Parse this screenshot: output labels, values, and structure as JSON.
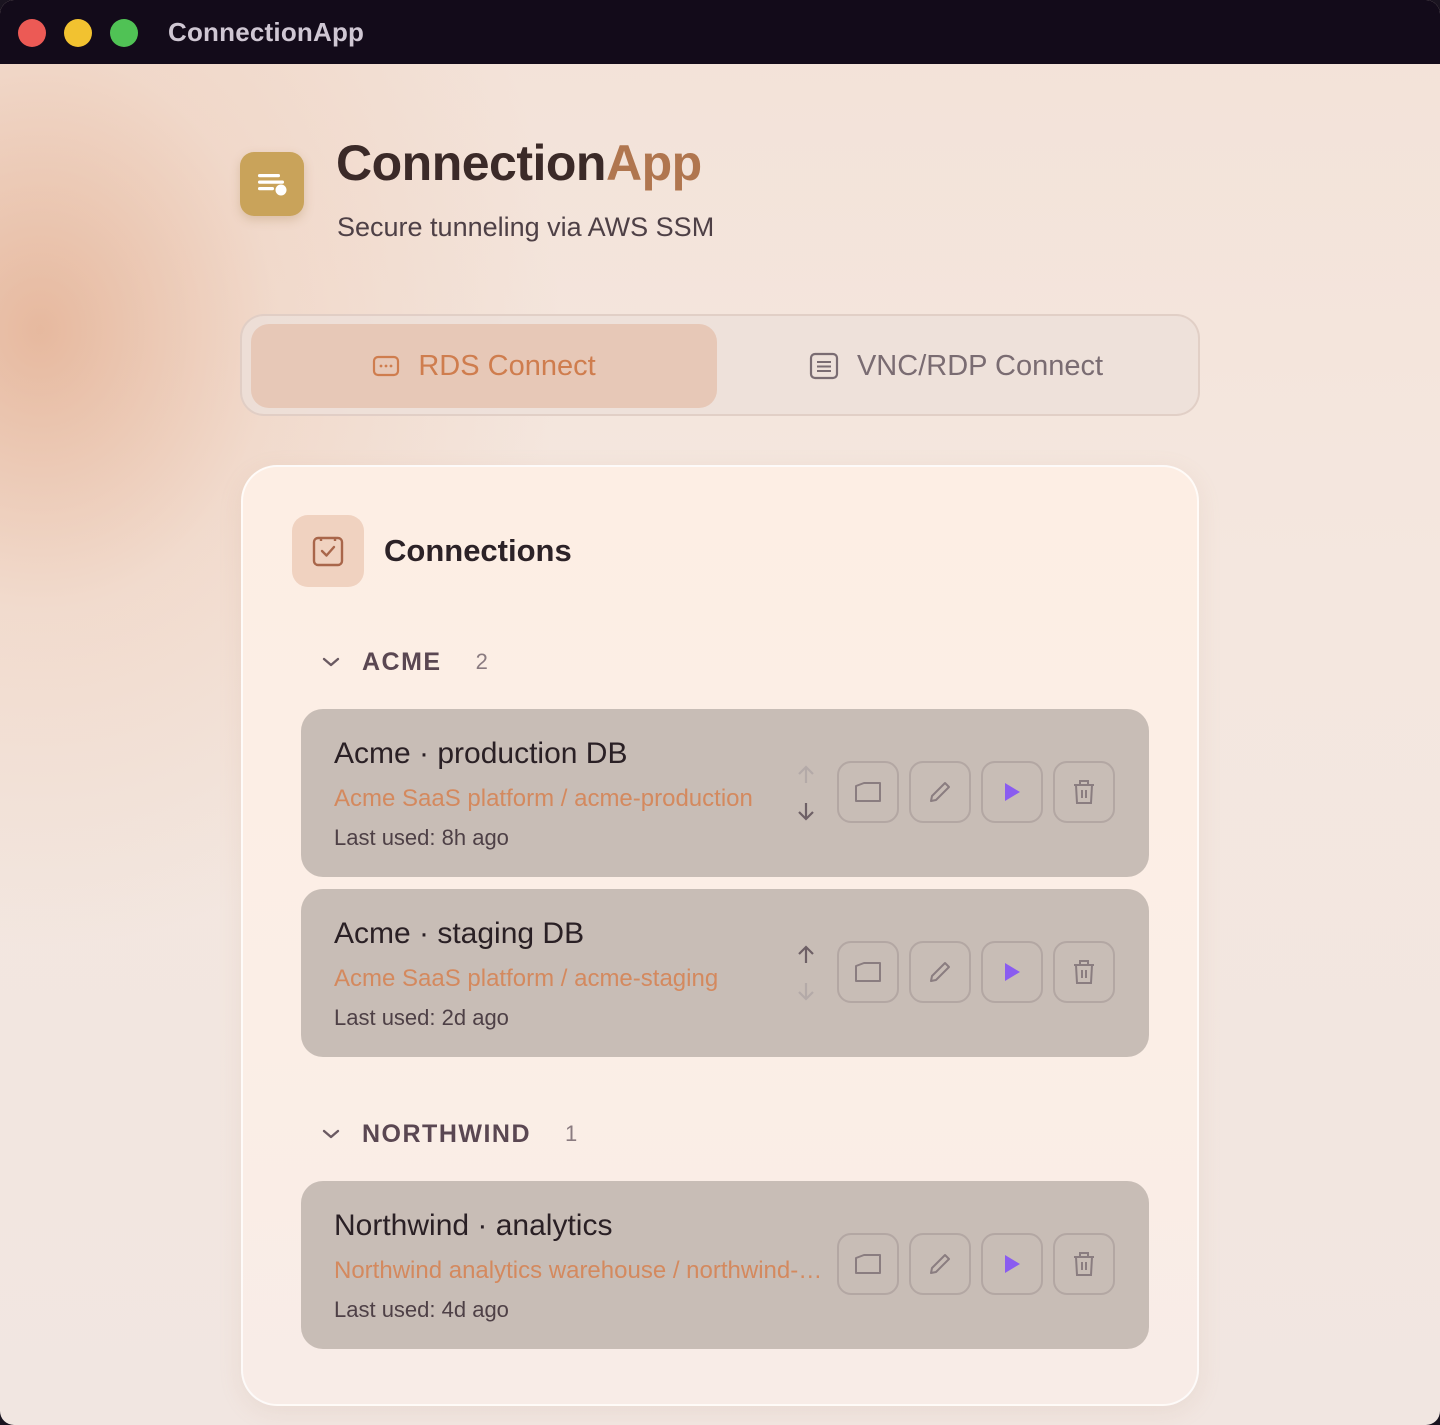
{
  "window": {
    "title": "ConnectionApp"
  },
  "header": {
    "title_main": "Connection",
    "title_accent": "App",
    "subtitle": "Secure tunneling via AWS SSM",
    "logo_icon": "list-icon"
  },
  "tabs": [
    {
      "label": "RDS Connect",
      "icon": "database-icon",
      "active": true
    },
    {
      "label": "VNC/RDP Connect",
      "icon": "screen-icon",
      "active": false
    }
  ],
  "connections_panel": {
    "title": "Connections",
    "icon": "check-square-icon",
    "groups": [
      {
        "name": "ACME",
        "count": "2",
        "items": [
          {
            "name": "Acme · production DB",
            "path": "Acme SaaS platform / acme-production",
            "last_used": "Last used: 8h ago"
          },
          {
            "name": "Acme · staging DB",
            "path": "Acme SaaS platform / acme-staging",
            "last_used": "Last used: 2d ago"
          }
        ]
      },
      {
        "name": "NORTHWIND",
        "count": "1",
        "items": [
          {
            "name": "Northwind · analytics",
            "path": "Northwind analytics warehouse / northwind-analytics",
            "last_used": "Last used: 4d ago"
          }
        ]
      }
    ]
  },
  "colors": {
    "accent": "#cf7d4e",
    "play": "#8a5cf0",
    "card_row": "#c8bdb6",
    "logo": "#c9a35a"
  }
}
